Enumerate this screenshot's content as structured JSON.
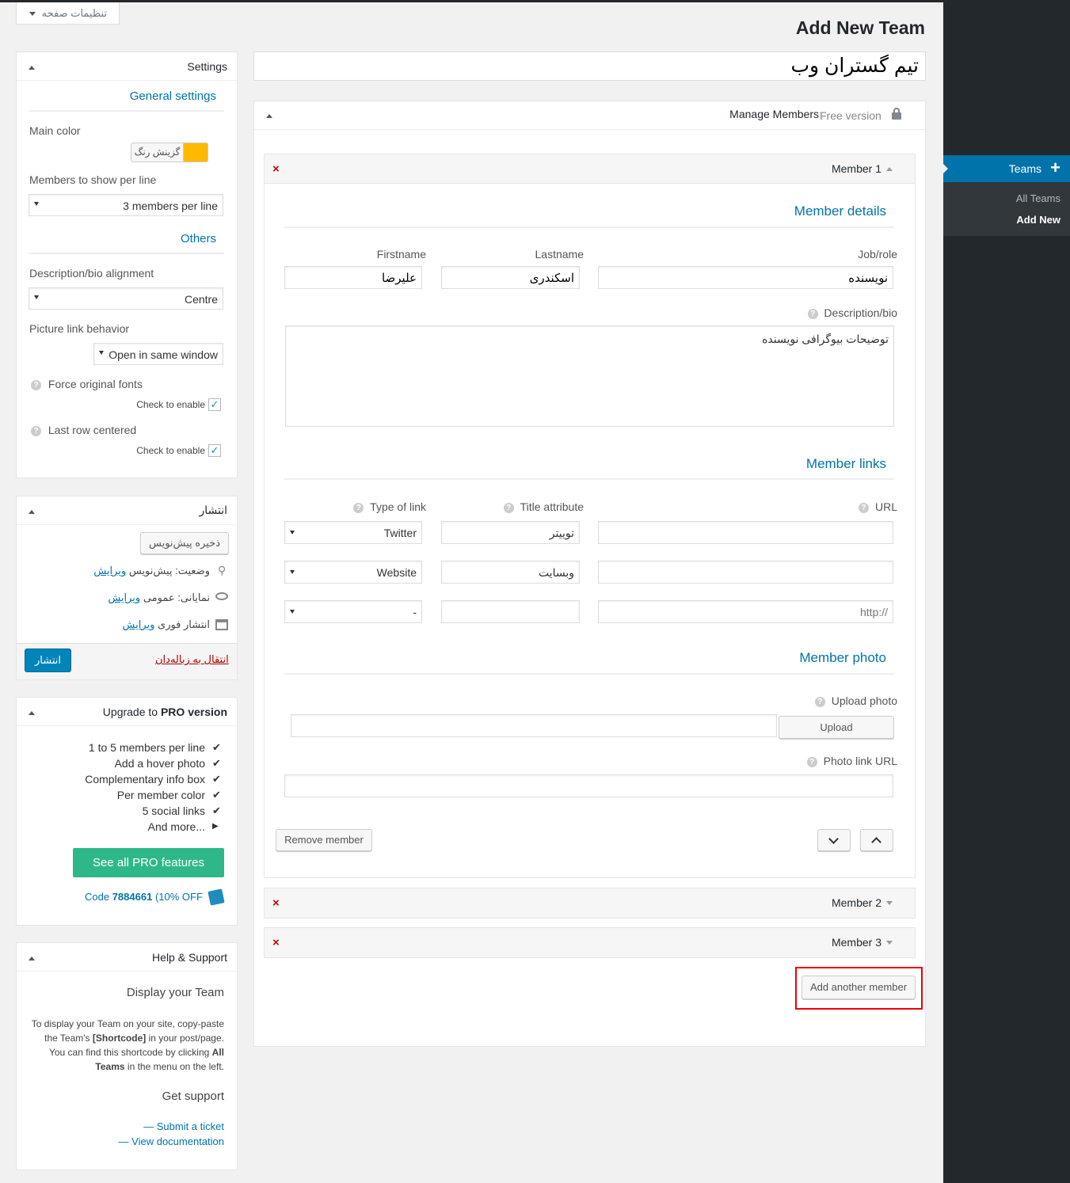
{
  "screen_options": "تنظیمات صفحه",
  "page_title": "Add New Team",
  "team_title": "تیم گستران وب",
  "admin_menu": {
    "teams": "Teams",
    "plus": "+",
    "all_teams": "All Teams",
    "add_new": "Add New"
  },
  "settings": {
    "title": "Settings",
    "general": "General settings",
    "main_color": "Main color",
    "color_button": "گزینش رنگ",
    "accent_color": "#ffb900",
    "members_per_line_label": "Members to show per line",
    "members_per_line_value": "3 members per line",
    "others": "Others",
    "desc_align_label": "Description/bio alignment",
    "desc_align_value": "Centre",
    "picture_link_label": "Picture link behavior",
    "picture_link_value": "Open in same window",
    "force_fonts": "Force original fonts",
    "check_to_enable": "Check to enable",
    "last_row": "Last row centered",
    "check_to_enable_2": "Check to enable"
  },
  "publish": {
    "title": "انتشار",
    "save_draft": "ذخیره پیش‌نویس",
    "status_label": "وضعیت:",
    "status_value": "پیش‌نویس",
    "visibility_label": "نمایانی:",
    "visibility_value": "عمومی",
    "schedule": "انتشار فوری",
    "edit": "ویرایش",
    "trash": "انتقال به زباله‌دان",
    "publish_button": "انتشار"
  },
  "upgrade": {
    "title_prefix": "Upgrade to",
    "title_bold": "PRO version",
    "features": [
      "1 to 5 members per line",
      "Add a hover photo",
      "Complementary info box",
      "Per member color",
      "5 social links",
      "And more..."
    ],
    "cta": "See all PRO features",
    "discount_prefix": "(10% OFF",
    "discount_code_label": "Code",
    "discount_code": "7884661",
    "discount_suffix": ")"
  },
  "help": {
    "title": "Help & Support",
    "display_title": "Display your Team",
    "display_text_1": "To display your Team on your site, copy-paste",
    "display_text_2a": "the Team's",
    "display_text_2b": "[Shortcode]",
    "display_text_2c": "in your post/page.",
    "display_text_3a": "You can find this shortcode by clicking",
    "display_text_3b": "All",
    "display_text_4a": "Teams",
    "display_text_4b": "in the menu on the left.",
    "support_title": "Get support",
    "submit_ticket": "— Submit a ticket",
    "view_docs": "— View documentation"
  },
  "manage": {
    "title": "Manage Members",
    "free_version": "Free version",
    "member1": "Member 1",
    "member2": "Member 2",
    "member3": "Member 3",
    "x": "×",
    "member_details": "Member details",
    "firstname": "Firstname",
    "lastname": "Lastname",
    "jobrole": "Job/role",
    "firstname_val": "علیرضا",
    "lastname_val": "اسکندری",
    "jobrole_val": "نویسنده",
    "description": "Description/bio",
    "description_val": "توضیحات بیوگرافی نویسنده",
    "member_links": "Member links",
    "type_of_link": "Type of link",
    "title_attr": "Title attribute",
    "url": "URL",
    "links": [
      {
        "type": "Twitter",
        "title": "توییتر",
        "url": ""
      },
      {
        "type": "Website",
        "title": "وبسایت",
        "url": ""
      },
      {
        "type": "-",
        "title": "",
        "url": "http://"
      }
    ],
    "member_photo": "Member photo",
    "upload_photo": "Upload photo",
    "upload": "Upload",
    "photo_link": "Photo link URL",
    "remove_member": "Remove member",
    "add_another": "Add another member"
  }
}
